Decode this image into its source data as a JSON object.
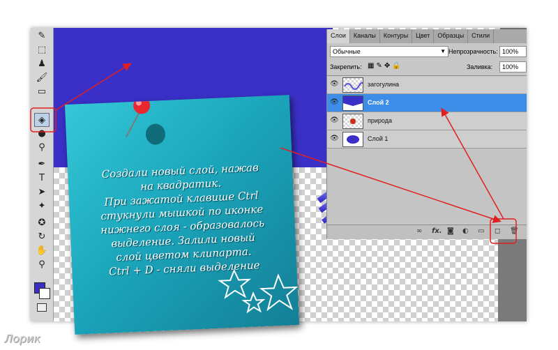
{
  "panel": {
    "tabs": [
      {
        "label": "Слои",
        "active": true
      },
      {
        "label": "Каналы"
      },
      {
        "label": "Контуры"
      },
      {
        "label": "Цвет"
      },
      {
        "label": "Образцы"
      },
      {
        "label": "Стили"
      }
    ],
    "blend_mode": "Обычные",
    "opacity_label": "Непрозрачность:",
    "opacity_value": "100%",
    "lock_label": "Закрепить:",
    "fill_label": "Заливка:",
    "fill_value": "100%",
    "layers": [
      {
        "name": "загогулина",
        "selected": false
      },
      {
        "name": "Слой 2",
        "selected": true
      },
      {
        "name": "природа",
        "selected": false
      },
      {
        "name": "Слой 1",
        "selected": false
      }
    ],
    "bottom_icons": [
      "link-icon",
      "fx-icon",
      "mask-icon",
      "adjustment-icon",
      "folder-icon",
      "new-layer-icon",
      "trash-icon"
    ],
    "fx_label": "fx."
  },
  "note": {
    "lines": [
      "Создали новый слой, нажав",
      "на квадратик.",
      "При зажатой клавише Ctrl",
      "стукнули мышкой по иконке",
      "нижнего слоя - образовалось",
      "выделение.  Залили новый",
      "слой цветом клипарта.",
      "Ctrl + D  - сняли выделение"
    ]
  },
  "watermark": "Лорик",
  "colors": {
    "foreground": "#3b2fc0",
    "background": "#ffffff",
    "selection": "#3d8ee8",
    "annotation": "#e02020",
    "note": "#1ba6bc"
  }
}
